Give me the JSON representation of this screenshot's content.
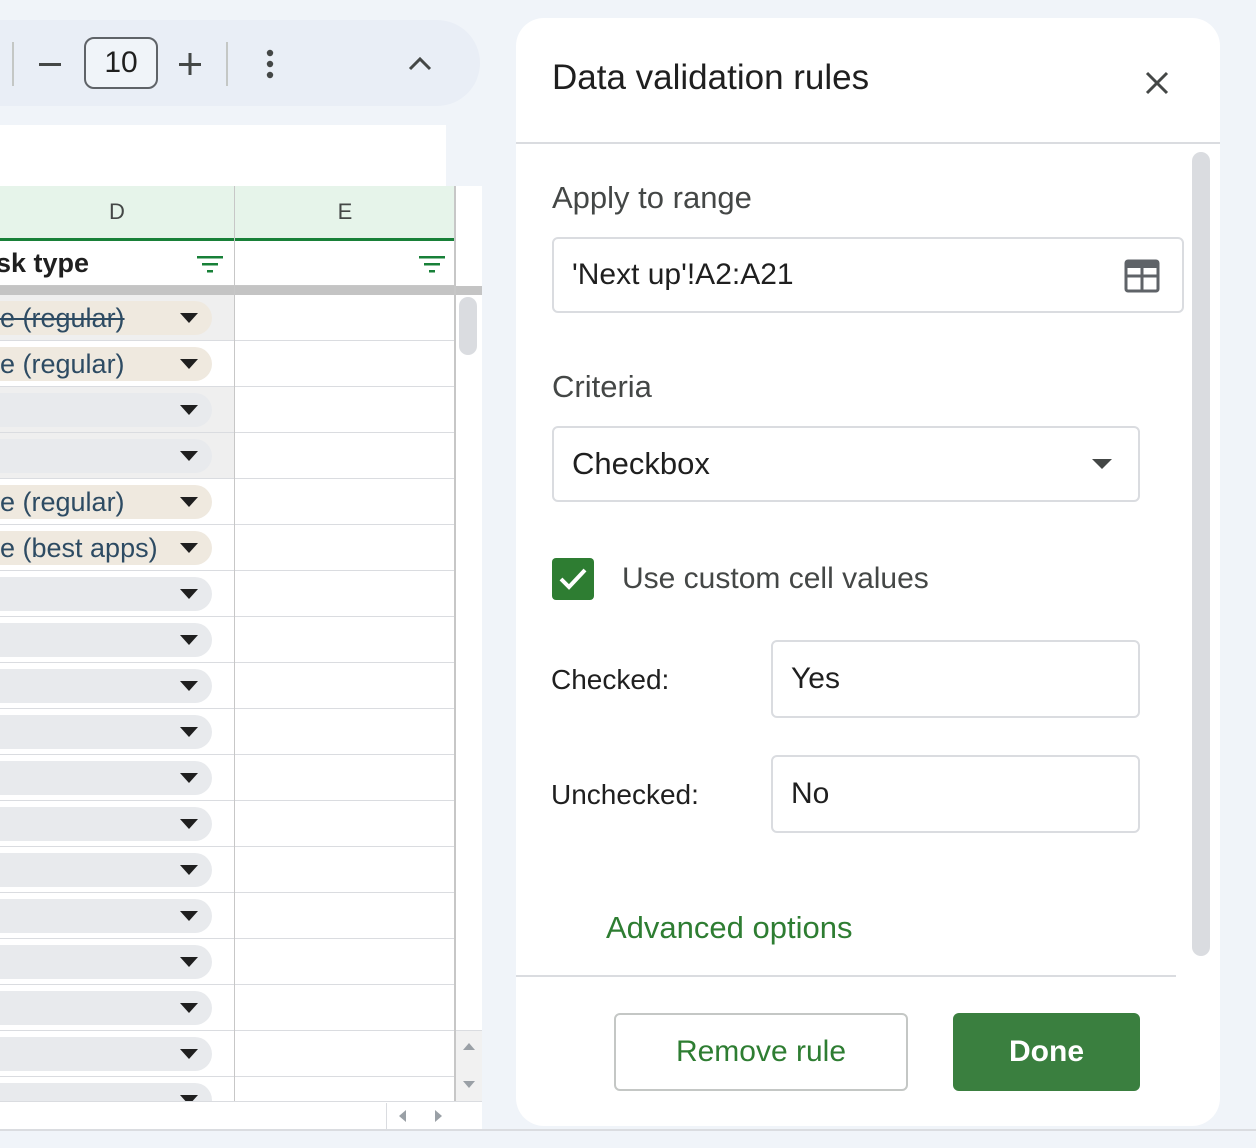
{
  "toolbar": {
    "font_size_value": "10",
    "decrease_label": "−",
    "increase_label": "+"
  },
  "sheet": {
    "columns": [
      "D",
      "E"
    ],
    "header_d": "sk type",
    "rows": [
      {
        "text": "e (regular)",
        "style": "tan",
        "strike": true,
        "shaded": true
      },
      {
        "text": "e (regular)",
        "style": "tan",
        "strike": false,
        "shaded": false
      },
      {
        "text": "",
        "style": "gray",
        "strike": false,
        "shaded": true
      },
      {
        "text": "",
        "style": "gray",
        "strike": false,
        "shaded": true
      },
      {
        "text": "e (regular)",
        "style": "tan",
        "strike": false,
        "shaded": false
      },
      {
        "text": "e (best apps)",
        "style": "tan",
        "strike": false,
        "shaded": false
      },
      {
        "text": "",
        "style": "gray",
        "strike": false,
        "shaded": false
      },
      {
        "text": "",
        "style": "gray",
        "strike": false,
        "shaded": false
      },
      {
        "text": "",
        "style": "gray",
        "strike": false,
        "shaded": false
      },
      {
        "text": "",
        "style": "gray",
        "strike": false,
        "shaded": false
      },
      {
        "text": "",
        "style": "gray",
        "strike": false,
        "shaded": false
      },
      {
        "text": "",
        "style": "gray",
        "strike": false,
        "shaded": false
      },
      {
        "text": "",
        "style": "gray",
        "strike": false,
        "shaded": false
      },
      {
        "text": "",
        "style": "gray",
        "strike": false,
        "shaded": false
      },
      {
        "text": "",
        "style": "gray",
        "strike": false,
        "shaded": false
      },
      {
        "text": "",
        "style": "gray",
        "strike": false,
        "shaded": false
      },
      {
        "text": "",
        "style": "gray",
        "strike": false,
        "shaded": false
      },
      {
        "text": "",
        "style": "gray",
        "strike": false,
        "shaded": false
      }
    ]
  },
  "panel": {
    "title": "Data validation rules",
    "apply_label": "Apply to range",
    "range_value": "'Next up'!A2:A21",
    "criteria_label": "Criteria",
    "criteria_value": "Checkbox",
    "custom_values_label": "Use custom cell values",
    "custom_values_checked": true,
    "checked_label": "Checked:",
    "checked_value": "Yes",
    "unchecked_label": "Unchecked:",
    "unchecked_value": "No",
    "advanced_label": "Advanced options",
    "remove_label": "Remove rule",
    "done_label": "Done"
  },
  "colors": {
    "accent_green": "#2e7d32",
    "done_bg": "#3a7f3f",
    "column_header_bg": "#e6f4ea",
    "chip_tan": "#efe9df",
    "chip_gray": "#e8eaed",
    "chip_text": "#2d4b63"
  },
  "icons": [
    "minus-icon",
    "plus-icon",
    "more-vert-icon",
    "chevron-up-icon",
    "filter-icon",
    "close-icon",
    "grid-select-icon",
    "dropdown-arrow-icon",
    "checkmark-icon"
  ]
}
